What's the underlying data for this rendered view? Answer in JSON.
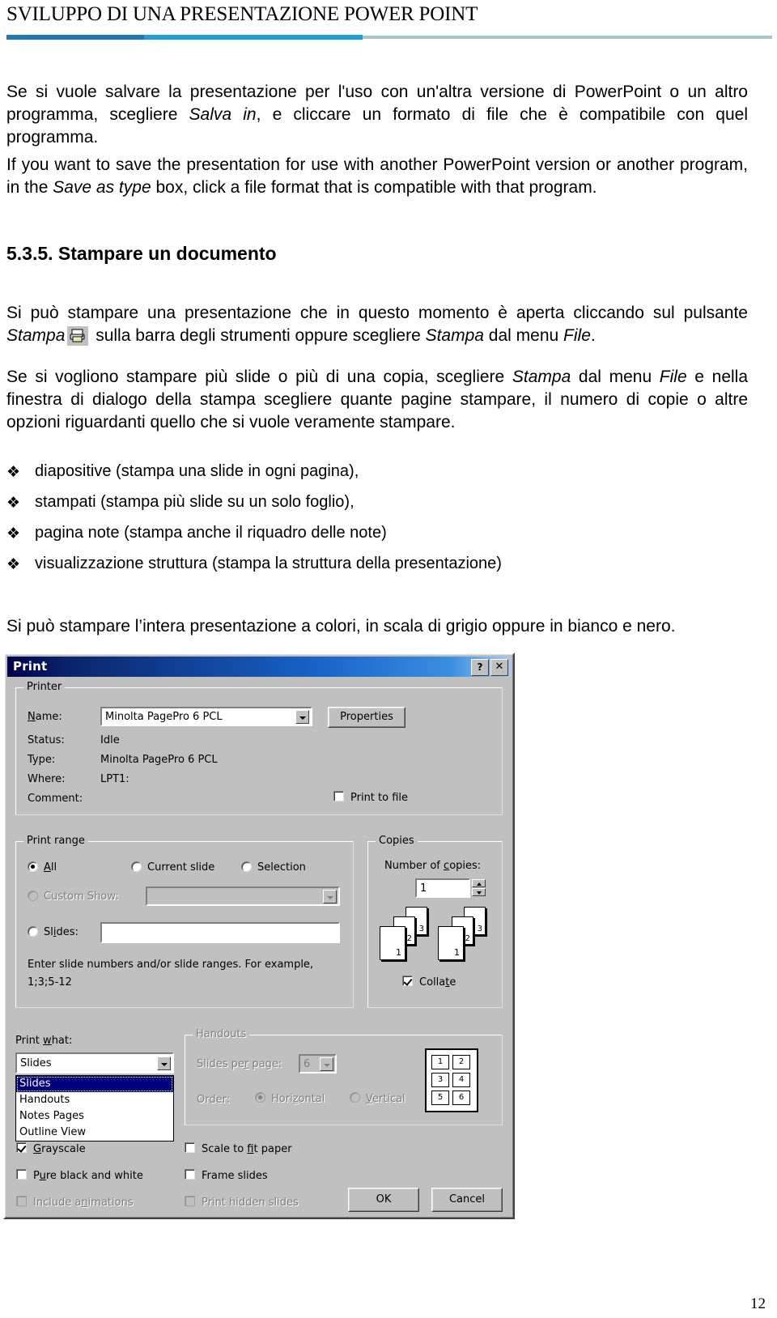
{
  "header": {
    "title": "SVILUPPO DI UNA PRESENTAZIONE POWER POINT",
    "rule_colors": [
      "#1F77B4",
      "#1CA0DC",
      "#A8C8C8"
    ]
  },
  "content": {
    "para_it_1a": "Se si vuole salvare la presentazione per l'uso con un'altra versione di PowerPoint o un altro programma, scegliere ",
    "para_it_1_em": "Salva in",
    "para_it_1b": ", e cliccare un formato di file che è compatibile con quel programma.",
    "para_en_1a": "If you want to save the presentation for use with another PowerPoint version or another program, in the ",
    "para_en_1_em": "Save as type",
    "para_en_1b": " box, click a file format that is compatible with that program.",
    "section_heading": "5.3.5. Stampare un documento",
    "para_2a": "Si può stampare una presentazione che in questo momento è aperta cliccando sul pulsante ",
    "para_2_em1": "Stampa",
    "para_2b": " sulla barra degli strumenti oppure scegliere ",
    "para_2_em2": "Stampa",
    "para_2c": " dal menu ",
    "para_2_em3": "File",
    "para_2d": ".",
    "printer_icon_name": "printer-icon",
    "para_3a": "Se si vogliono stampare più slide o più di una copia, scegliere ",
    "para_3_em1": "Stampa",
    "para_3b": " dal menu ",
    "para_3_em2": "File",
    "para_3c": " e nella finestra di dialogo della stampa scegliere quante pagine stampare, il numero di copie o altre opzioni riguardanti quello che si vuole veramente stampare.",
    "para_4": "Si può stampare l’intera presentazione a colori, in scala di grigio oppure in bianco e nero.",
    "bullet_mark": "❖",
    "bullets": [
      "diapositive (stampa una slide in ogni pagina),",
      "stampati (stampa più slide su un solo foglio),",
      "pagina note (stampa anche il riquadro delle note)",
      "visualizzazione struttura (stampa la struttura della presentazione)"
    ]
  },
  "dialog": {
    "title": "Print",
    "help_button": "?",
    "close_button": "✕",
    "printer_group": {
      "legend": "Printer",
      "name_label": "Name:",
      "name_value": "Minolta PagePro 6 PCL",
      "properties_button": "Properties",
      "status_label": "Status:",
      "status_value": "Idle",
      "type_label": "Type:",
      "type_value": "Minolta PagePro 6 PCL",
      "where_label": "Where:",
      "where_value": "LPT1:",
      "comment_label": "Comment:",
      "comment_value": "",
      "print_to_file_label": "Print to file",
      "print_to_file_checked": false
    },
    "print_range_group": {
      "legend": "Print range",
      "all_label": "All",
      "all_selected": true,
      "current_slide_label": "Current slide",
      "current_slide_selected": false,
      "selection_label": "Selection",
      "selection_selected": false,
      "custom_show_label": "Custom Show:",
      "custom_show_selected": false,
      "custom_show_disabled": true,
      "custom_show_value": "",
      "slides_label": "Slides:",
      "slides_selected": false,
      "slides_value": "",
      "hint_line1": "Enter slide numbers and/or slide ranges. For example,",
      "hint_line2": "1;3;5-12"
    },
    "copies_group": {
      "legend": "Copies",
      "number_label": "Number of copies:",
      "number_value": "1",
      "collate_label": "Collate",
      "collate_checked": true,
      "collate_pages": [
        "3",
        "2",
        "1"
      ]
    },
    "print_what": {
      "label": "Print what:",
      "value": "Slides",
      "options": [
        "Slides",
        "Handouts",
        "Notes Pages",
        "Outline View"
      ],
      "selected_index": 0
    },
    "handouts_group": {
      "legend": "Handouts",
      "disabled": true,
      "slides_per_page_label": "Slides per page:",
      "slides_per_page_value": "6",
      "order_label": "Order:",
      "horizontal_label": "Horizontal",
      "horizontal_selected": true,
      "vertical_label": "Vertical",
      "vertical_selected": false,
      "preview_cells": [
        "1",
        "2",
        "3",
        "4",
        "5",
        "6"
      ]
    },
    "options": {
      "grayscale_label": "Grayscale",
      "grayscale_checked": true,
      "pure_bw_label": "Pure black and white",
      "pure_bw_checked": false,
      "include_animations_label": "Include animations",
      "include_animations_checked": false,
      "include_animations_disabled": true,
      "scale_to_fit_label": "Scale to fit paper",
      "scale_to_fit_checked": false,
      "frame_slides_label": "Frame slides",
      "frame_slides_checked": false,
      "print_hidden_label": "Print hidden slides",
      "print_hidden_checked": false,
      "print_hidden_disabled": true
    },
    "ok_button": "OK",
    "cancel_button": "Cancel"
  },
  "footer": {
    "page_number": "12"
  }
}
